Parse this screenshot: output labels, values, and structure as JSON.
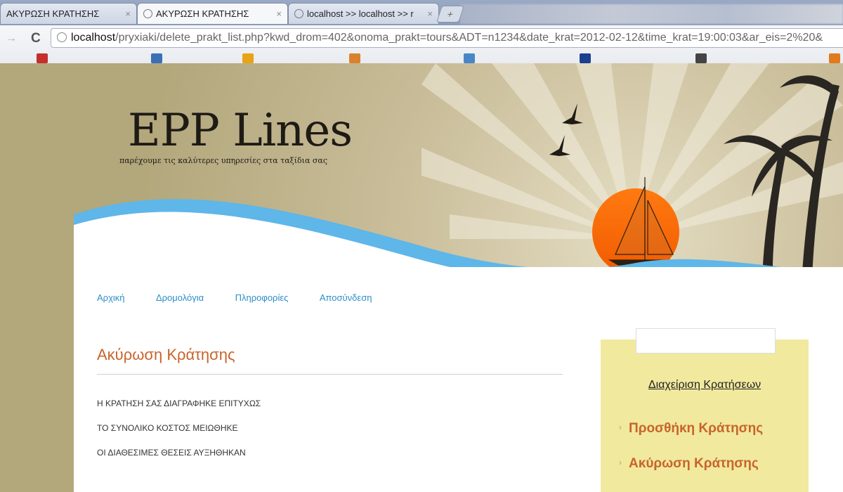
{
  "browser": {
    "tabs": [
      {
        "label": "ΑΚΥΡΩΣΗ ΚΡΑΤΗΣΗΣ"
      },
      {
        "label": "ΑΚΥΡΩΣΗ ΚΡΑΤΗΣΗΣ"
      },
      {
        "label": "localhost >> localhost >> r"
      }
    ],
    "url_host": "localhost",
    "url_rest": "/pryxiaki/delete_prakt_list.php?kwd_drom=402&onoma_prakt=tours&ADT=n1234&date_krat=2012-02-12&time_krat=19:00:03&ar_eis=2%20&"
  },
  "site": {
    "logo": "EPP Lines",
    "tagline": "παρέχουμε τις καλύτερες υπηρεσίες στα ταξίδια σας"
  },
  "nav": [
    "Αρχική",
    "Δρομολόγια",
    "Πληροφορίες",
    "Αποσύνδεση"
  ],
  "main": {
    "title": "Ακύρωση Κράτησης",
    "messages": [
      "Η ΚΡΑΤΗΣΗ ΣΑΣ ΔΙΑΓΡΑΦΗΚΕ ΕΠΙΤΥΧΩΣ",
      "ΤΟ ΣΥΝΟΛΙΚΟ ΚΟΣΤΟΣ ΜΕΙΩΘΗΚΕ",
      "ΟΙ ΔΙΑΘΕΣΙΜΕΣ ΘΕΣΕΙΣ ΑΥΞΗΘΗΚΑΝ"
    ]
  },
  "sidebar": {
    "heading": "Διαχείριση Κρατήσεων",
    "items": [
      "Προσθήκη Κράτησης",
      "Ακύρωση Κράτησης"
    ]
  },
  "colors": {
    "accent_orange": "#c8642c",
    "nav_blue": "#2b8fc5",
    "sidebar_bg": "#f1e99e",
    "page_bg": "#b3a77c"
  },
  "icons": [
    "globe-icon",
    "reload-icon",
    "forward-arrow-icon",
    "new-tab-icon",
    "close-icon",
    "sidebar-arrow-icon"
  ]
}
